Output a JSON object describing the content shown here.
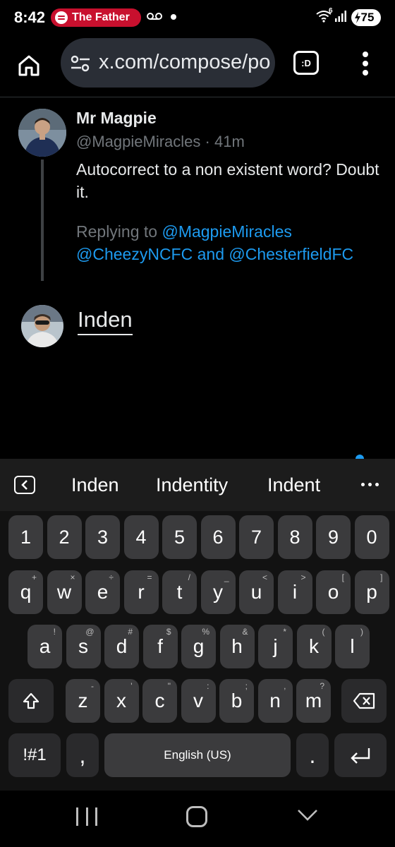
{
  "status_bar": {
    "time": "8:42",
    "now_playing": "The Father",
    "wifi_label": "6",
    "battery": "75"
  },
  "browser": {
    "url": "x.com/compose/po",
    "tab_label": ":D"
  },
  "tweet": {
    "author_name": "Mr Magpie",
    "author_handle": "@MagpieMiracles",
    "separator": "·",
    "time_ago": "41m",
    "text": "Autocorrect to a non existent word? Doubt it.",
    "replying_to_prefix": "Replying to",
    "reply_mention_1": "@MagpieMiracles",
    "reply_mention_2": "@CheezyNCFC",
    "reply_conjunction": "and",
    "reply_mention_3": "@ChesterfieldFC"
  },
  "compose": {
    "text": "Inden"
  },
  "keyboard": {
    "suggestions": [
      "Inden",
      "Indentity",
      "Indent"
    ],
    "number_row": [
      "1",
      "2",
      "3",
      "4",
      "5",
      "6",
      "7",
      "8",
      "9",
      "0"
    ],
    "row1": [
      {
        "key": "q",
        "hint": "+"
      },
      {
        "key": "w",
        "hint": "×"
      },
      {
        "key": "e",
        "hint": "÷"
      },
      {
        "key": "r",
        "hint": "="
      },
      {
        "key": "t",
        "hint": "/"
      },
      {
        "key": "y",
        "hint": "_"
      },
      {
        "key": "u",
        "hint": "<"
      },
      {
        "key": "i",
        "hint": ">"
      },
      {
        "key": "o",
        "hint": "["
      },
      {
        "key": "p",
        "hint": "]"
      }
    ],
    "row2": [
      {
        "key": "a",
        "hint": "!"
      },
      {
        "key": "s",
        "hint": "@"
      },
      {
        "key": "d",
        "hint": "#"
      },
      {
        "key": "f",
        "hint": "$"
      },
      {
        "key": "g",
        "hint": "%"
      },
      {
        "key": "h",
        "hint": "&"
      },
      {
        "key": "j",
        "hint": "*"
      },
      {
        "key": "k",
        "hint": "("
      },
      {
        "key": "l",
        "hint": ")"
      }
    ],
    "row3": [
      {
        "key": "z",
        "hint": "-"
      },
      {
        "key": "x",
        "hint": "'"
      },
      {
        "key": "c",
        "hint": "\""
      },
      {
        "key": "v",
        "hint": ":"
      },
      {
        "key": "b",
        "hint": ";"
      },
      {
        "key": "n",
        "hint": ","
      },
      {
        "key": "m",
        "hint": "?"
      }
    ],
    "symbols_label": "!#1",
    "comma_label": ",",
    "space_label": "English (US)",
    "period_label": "."
  },
  "colors": {
    "accent": "#1d9bf0",
    "spotify_pill": "#c8102e",
    "key_bg": "#3b3b3d"
  }
}
